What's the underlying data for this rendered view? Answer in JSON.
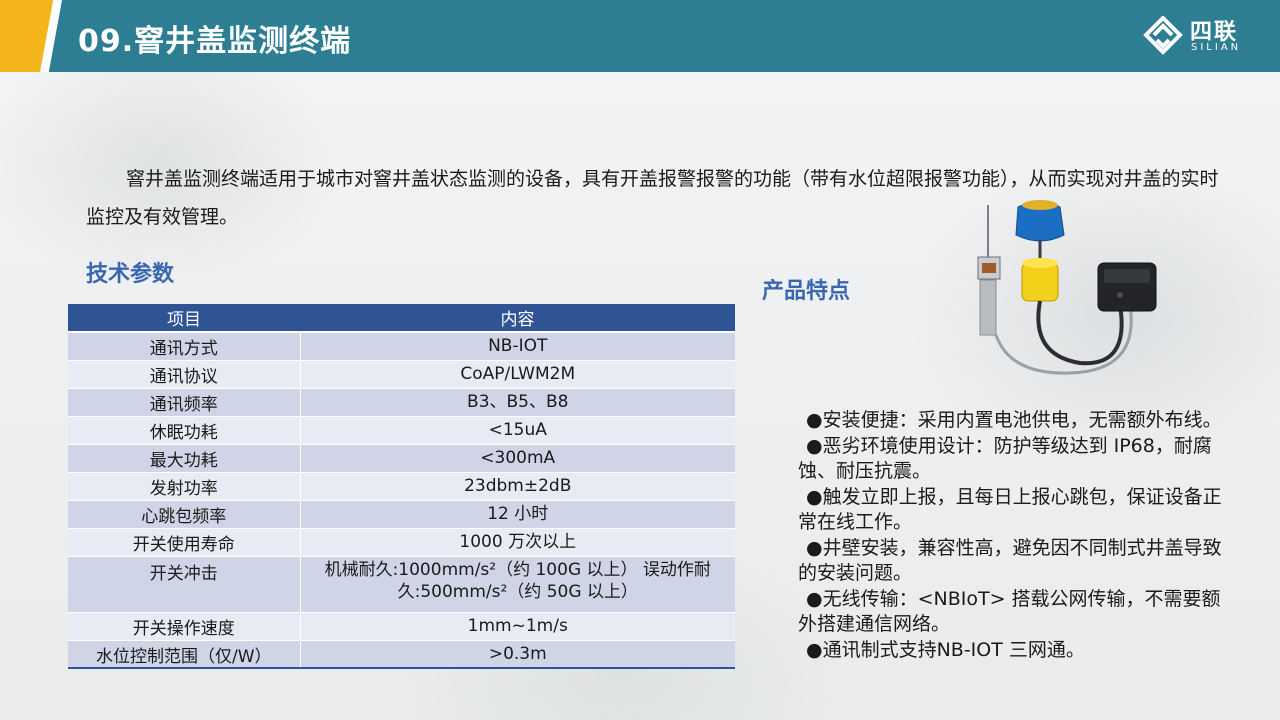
{
  "header": {
    "title": "09.窨井盖监测终端",
    "logo_cn": "四联",
    "logo_en": "SILIAN"
  },
  "intro": "窨井盖监测终端适用于城市对窨井盖状态监测的设备，具有开盖报警报警的功能（带有水位超限报警功能），从而实现对井盖的实时监控及有效管理。",
  "specs": {
    "heading": "技术参数",
    "columns": [
      "项目",
      "内容"
    ],
    "rows": [
      {
        "item": "通讯方式",
        "content": "NB-IOT"
      },
      {
        "item": "通讯协议",
        "content": "CoAP/LWM2M"
      },
      {
        "item": "通讯频率",
        "content": "B3、B5、B8"
      },
      {
        "item": "休眠功耗",
        "content": "<15uA"
      },
      {
        "item": "最大功耗",
        "content": "<300mA"
      },
      {
        "item": "发射功率",
        "content": "23dbm±2dB"
      },
      {
        "item": "心跳包频率",
        "content": "12 小时"
      },
      {
        "item": "开关使用寿命",
        "content": "1000 万次以上"
      },
      {
        "item": "开关冲击",
        "content": "机械耐久:1000mm/s²（约 100G 以上） 误动作耐久:500mm/s²（约 50G 以上）"
      },
      {
        "item": "开关操作速度",
        "content": "1mm~1m/s"
      },
      {
        "item": "水位控制范围（仅/W）",
        "content": ">0.3m"
      }
    ]
  },
  "features": {
    "heading": "产品特点",
    "items": [
      "●安装便捷：采用内置电池供电，无需额外布线。",
      "●恶劣环境使用设计：防护等级达到 IP68，耐腐蚀、耐压抗震。",
      "●触发立即上报，且每日上报心跳包，保证设备正常在线工作。",
      "●井壁安装，兼容性高，避免因不同制式井盖导致的安装问题。",
      "●无线传输：<NBIoT> 搭载公网传输，不需要额外搭建通信网络。",
      "●通讯制式支持NB-IOT 三网通。"
    ]
  },
  "colors": {
    "header_bg": "#2e7e93",
    "accent_yellow": "#f3b51a",
    "table_header": "#2f5496",
    "section_heading": "#3a67b0"
  }
}
